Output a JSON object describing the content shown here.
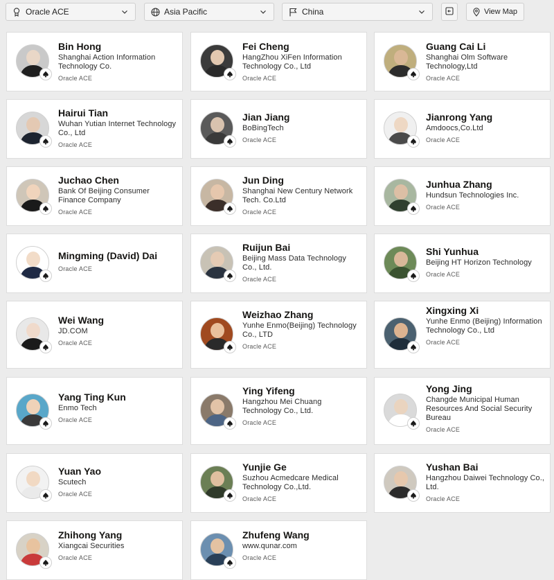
{
  "filters": {
    "program": "Oracle ACE",
    "region": "Asia Pacific",
    "country": "China",
    "view_map_label": "View Map"
  },
  "members": [
    {
      "name": "Bin Hong",
      "company": "Shanghai Action Information Technology Co.",
      "level": "Oracle ACE"
    },
    {
      "name": "Fei Cheng",
      "company": "HangZhou XiFen Information Technology Co., Ltd",
      "level": "Oracle ACE"
    },
    {
      "name": "Guang Cai Li",
      "company": "Shanghai Olm Software Technology,Ltd",
      "level": "Oracle ACE"
    },
    {
      "name": "Hairui Tian",
      "company": "Wuhan Yutian Internet Technology Co., Ltd",
      "level": "Oracle ACE"
    },
    {
      "name": "Jian Jiang",
      "company": "BoBingTech",
      "level": "Oracle ACE"
    },
    {
      "name": "Jianrong Yang",
      "company": "Amdoocs,Co.Ltd",
      "level": "Oracle ACE"
    },
    {
      "name": "Juchao Chen",
      "company": "Bank Of Beijing Consumer Finance Company",
      "level": "Oracle ACE"
    },
    {
      "name": "Jun Ding",
      "company": "Shanghai New Century Network Tech. Co.Ltd",
      "level": "Oracle ACE"
    },
    {
      "name": "Junhua Zhang",
      "company": "Hundsun Technologies Inc.",
      "level": "Oracle ACE"
    },
    {
      "name": "Mingming (David) Dai",
      "company": "",
      "level": "Oracle ACE"
    },
    {
      "name": "Ruijun Bai",
      "company": "Beijing Mass Data Technology Co., Ltd.",
      "level": "Oracle ACE"
    },
    {
      "name": "Shi Yunhua",
      "company": "Beijing HT Horizon Technology",
      "level": "Oracle ACE"
    },
    {
      "name": "Wei Wang",
      "company": "JD.COM",
      "level": "Oracle ACE"
    },
    {
      "name": "Weizhao Zhang",
      "company": "Yunhe Enmo(Beijing) Technology Co., LTD",
      "level": "Oracle ACE"
    },
    {
      "name": "Xingxing Xi",
      "company": "Yunhe Enmo (Beijing) Information Technology Co., Ltd",
      "level": "Oracle ACE"
    },
    {
      "name": "Yang Ting Kun",
      "company": "Enmo Tech",
      "level": "Oracle ACE"
    },
    {
      "name": "Ying Yifeng",
      "company": "Hangzhou Mei Chuang Technology Co., Ltd.",
      "level": "Oracle ACE"
    },
    {
      "name": "Yong Jing",
      "company": "Changde Municipal Human Resources And Social Security Bureau",
      "level": "Oracle ACE"
    },
    {
      "name": "Yuan Yao",
      "company": "Scutech",
      "level": "Oracle ACE"
    },
    {
      "name": "Yunjie Ge",
      "company": "Suzhou Acmedcare Medical Technology Co.,Ltd.",
      "level": "Oracle ACE"
    },
    {
      "name": "Yushan Bai",
      "company": "Hangzhou Daiwei Technology Co., Ltd.",
      "level": "Oracle ACE"
    },
    {
      "name": "Zhihong Yang",
      "company": "Xiangcai Securities",
      "level": "Oracle ACE"
    },
    {
      "name": "Zhufeng Wang",
      "company": "www.qunar.com",
      "level": "Oracle ACE"
    }
  ]
}
